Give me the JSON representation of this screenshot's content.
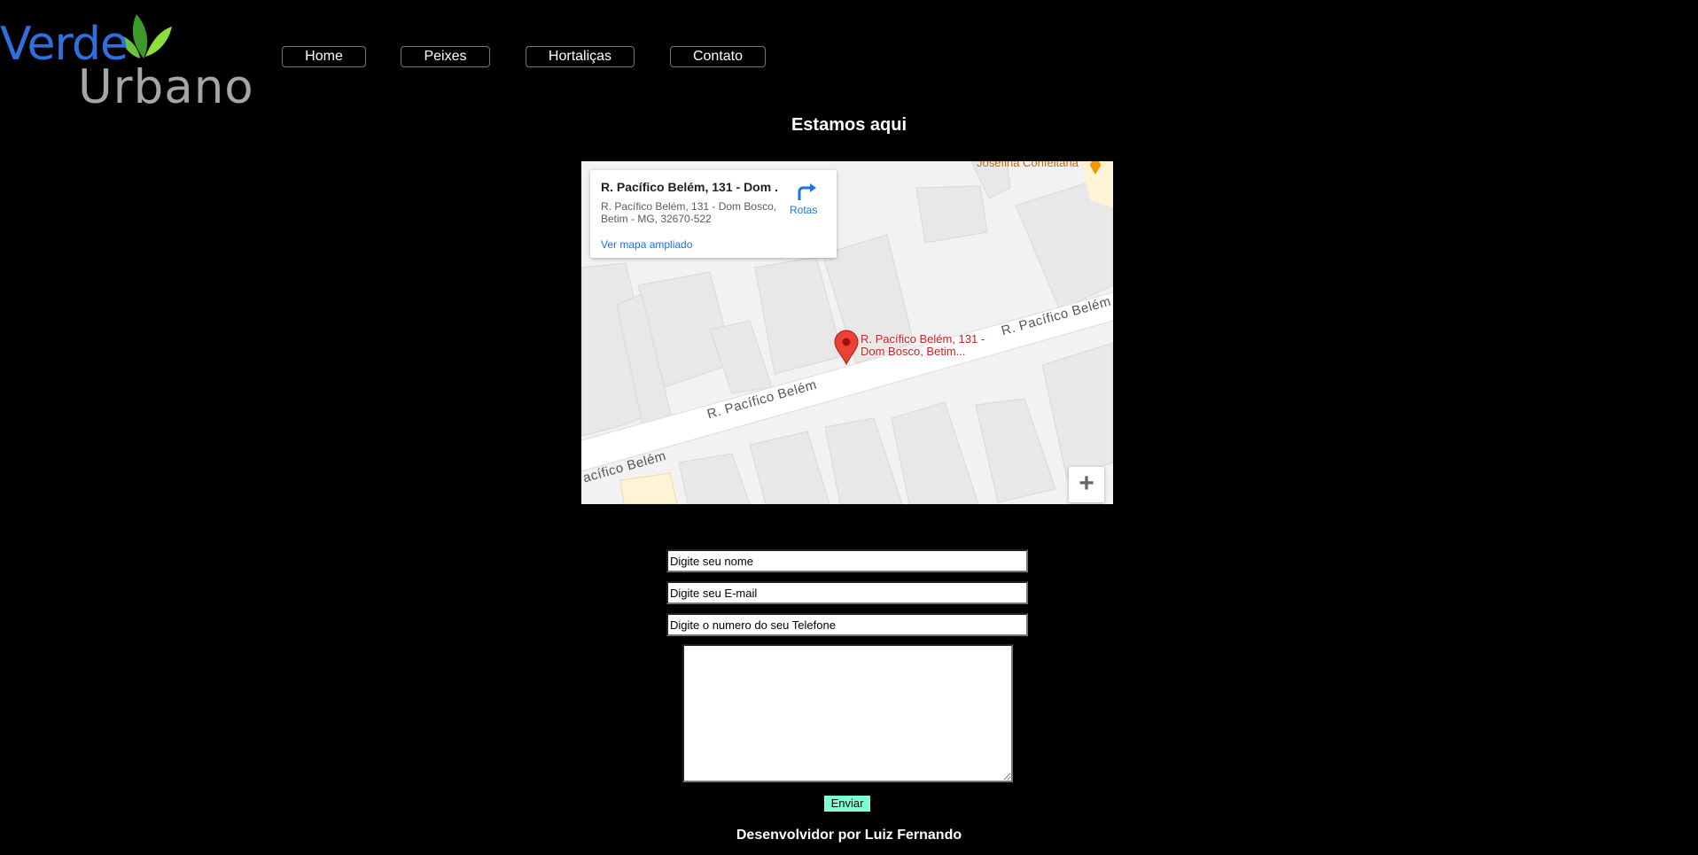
{
  "logo": {
    "word1": "Verde",
    "word2": "Urbano",
    "color_verde": "#2f6fde",
    "color_urbano": "#a6a6a6"
  },
  "nav": {
    "items": [
      {
        "label": "Home"
      },
      {
        "label": "Peixes"
      },
      {
        "label": "Hortaliças"
      },
      {
        "label": "Contato"
      }
    ]
  },
  "page_title": "Estamos aqui",
  "map": {
    "card_title": "R. Pacífico Belém, 131 - Dom ...",
    "card_address": "R. Pacífico Belém, 131 - Dom Bosco, Betim - MG, 32670-522",
    "card_link": "Ver mapa ampliado",
    "route_label": "Rotas",
    "pin_label": "R. Pacífico Belém, 131 - Dom Bosco, Betim...",
    "street_label_1": "R. Pacífico Belém",
    "street_label_2": "R. Pacífico Belém",
    "street_label_3": "acífico Belém",
    "poi_label": "Josefina Confeitaria",
    "zoom_in": "+"
  },
  "form": {
    "name_placeholder": "Digite seu nome",
    "email_placeholder": "Digite seu E-mail",
    "phone_placeholder": "Digite o numero do seu Telefone",
    "message_value": "",
    "submit_label": "Enviar",
    "submit_color": "#7fffd4"
  },
  "footer": "Desenvolvidor por Luiz Fernando"
}
